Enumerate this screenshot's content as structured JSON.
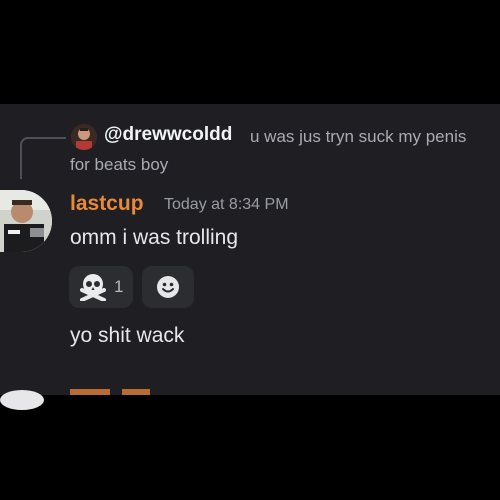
{
  "reply": {
    "username": "@drewwcoldd",
    "text_line1": "u was jus tryn suck my penis",
    "text_line2": "for beats boy"
  },
  "message": {
    "username": "lastcup",
    "timestamp": "Today at 8:34 PM",
    "text1": "omm i was trolling",
    "text2": "yo shit wack",
    "username_color": "#e8893a"
  },
  "reactions": [
    {
      "emoji": "skull-and-crossbones-icon",
      "count": "1"
    }
  ],
  "add_reaction_icon": "smiley-icon"
}
